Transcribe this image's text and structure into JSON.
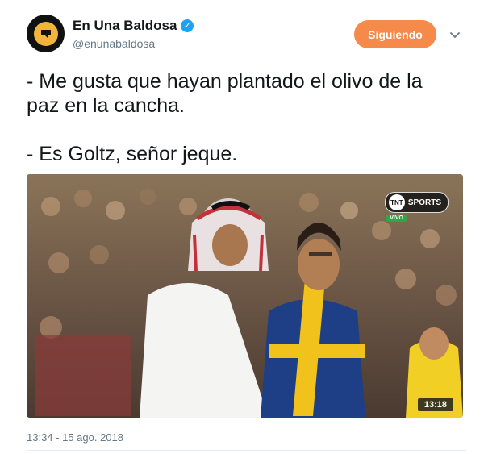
{
  "header": {
    "display_name": "En Una Baldosa",
    "handle": "@enunabaldosa",
    "follow_label": "Siguiendo"
  },
  "tweet": {
    "text": "- Me gusta que hayan plantado el olivo de la\npaz en la cancha.\n\n- Es Goltz, señor jeque.",
    "timestamp": "13:34 - 15 ago. 2018"
  },
  "media": {
    "channel_logo": "SPORTS",
    "channel_mark": "TNT",
    "live_tag": "VIVO",
    "clock": "13:18"
  },
  "icons": {
    "verified": "verified-badge-icon",
    "caret": "chevron-down-icon"
  },
  "colors": {
    "follow_button": "#f58a4a",
    "verified": "#1da1f2",
    "secondary_text": "#657786"
  }
}
